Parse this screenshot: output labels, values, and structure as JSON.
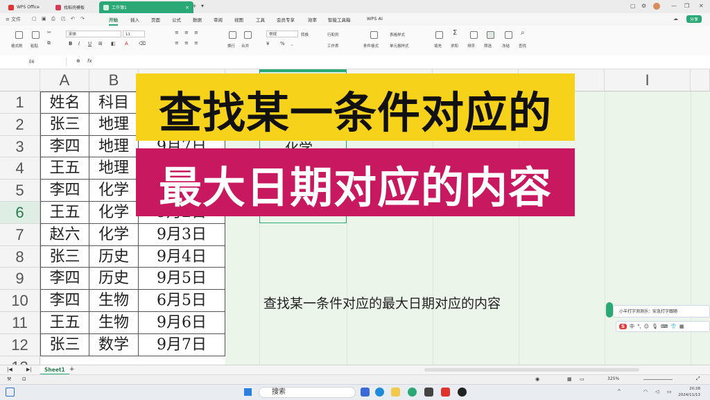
{
  "window": {
    "tabs": [
      {
        "label": "WPS Office",
        "color": "#e0322f"
      },
      {
        "label": "找稻壳模板",
        "color": "#d23a55"
      },
      {
        "label": "工作簿1",
        "color": "#2aa876"
      }
    ],
    "new_tab": "+",
    "dropdown": "▾"
  },
  "quickbar": {
    "menu": "≡ 文件",
    "tabs": [
      "开始",
      "插入",
      "页面",
      "公式",
      "数据",
      "审阅",
      "视图",
      "工具",
      "会员专享",
      "效率",
      "智能工具箱"
    ],
    "active_tab": "开始",
    "ai_label": "WPS AI",
    "share_label": "分享"
  },
  "ribbon": {
    "format_painter": "格式刷",
    "paste": "粘贴",
    "font_name": "宋体",
    "font_size": "11",
    "wrap": "换行",
    "merge": "合并",
    "number_format": "常规",
    "convert": "转换",
    "row_col": "行和列",
    "worksheet": "工作表",
    "cond_format": "条件格式",
    "table_style": "表格样式",
    "cell_style": "单元格样式",
    "fill": "填充",
    "sum": "求和",
    "sort": "排序",
    "filter": "筛选",
    "freeze": "冻结",
    "find": "查找"
  },
  "formula_bar": {
    "cell_ref": "E6",
    "fx": "fx"
  },
  "sheet": {
    "columns": [
      "A",
      "B",
      "I"
    ],
    "rows": [
      "1",
      "2",
      "3",
      "4",
      "5",
      "6",
      "7",
      "8",
      "9",
      "10",
      "11",
      "12",
      "13"
    ],
    "selected_row": "6",
    "header": {
      "name": "姓名",
      "subject": "科目",
      "date": ""
    },
    "data": [
      {
        "name": "张三",
        "subject": "地理",
        "date": ""
      },
      {
        "name": "李四",
        "subject": "地理",
        "date": "9月7日"
      },
      {
        "name": "王五",
        "subject": "地理",
        "date": ""
      },
      {
        "name": "李四",
        "subject": "化学",
        "date": ""
      },
      {
        "name": "王五",
        "subject": "化学",
        "date": "9月2日"
      },
      {
        "name": "赵六",
        "subject": "化学",
        "date": "9月3日"
      },
      {
        "name": "张三",
        "subject": "历史",
        "date": "9月4日"
      },
      {
        "name": "李四",
        "subject": "历史",
        "date": "9月5日"
      },
      {
        "name": "李四",
        "subject": "生物",
        "date": "6月5日"
      },
      {
        "name": "王五",
        "subject": "生物",
        "date": "9月6日"
      },
      {
        "name": "张三",
        "subject": "数学",
        "date": "9月7日"
      }
    ],
    "partial_text": "化学",
    "note": "查找某一条件对应的最大日期对应的内容"
  },
  "overlay": {
    "line1": "查找某一条件对应的",
    "line2": "最大日期对应的内容",
    "color1": "#f7d21b",
    "color2": "#c8185f"
  },
  "ime": {
    "tip": "小羊打字测测乐：安急打字跟随",
    "logo": "S",
    "mode": "中"
  },
  "tabs_bar": {
    "sheet_name": "Sheet1",
    "add": "+"
  },
  "status": {
    "zoom": "325%"
  },
  "taskbar": {
    "search": "搜索",
    "time": "20:28",
    "date": "2024/11/13"
  }
}
